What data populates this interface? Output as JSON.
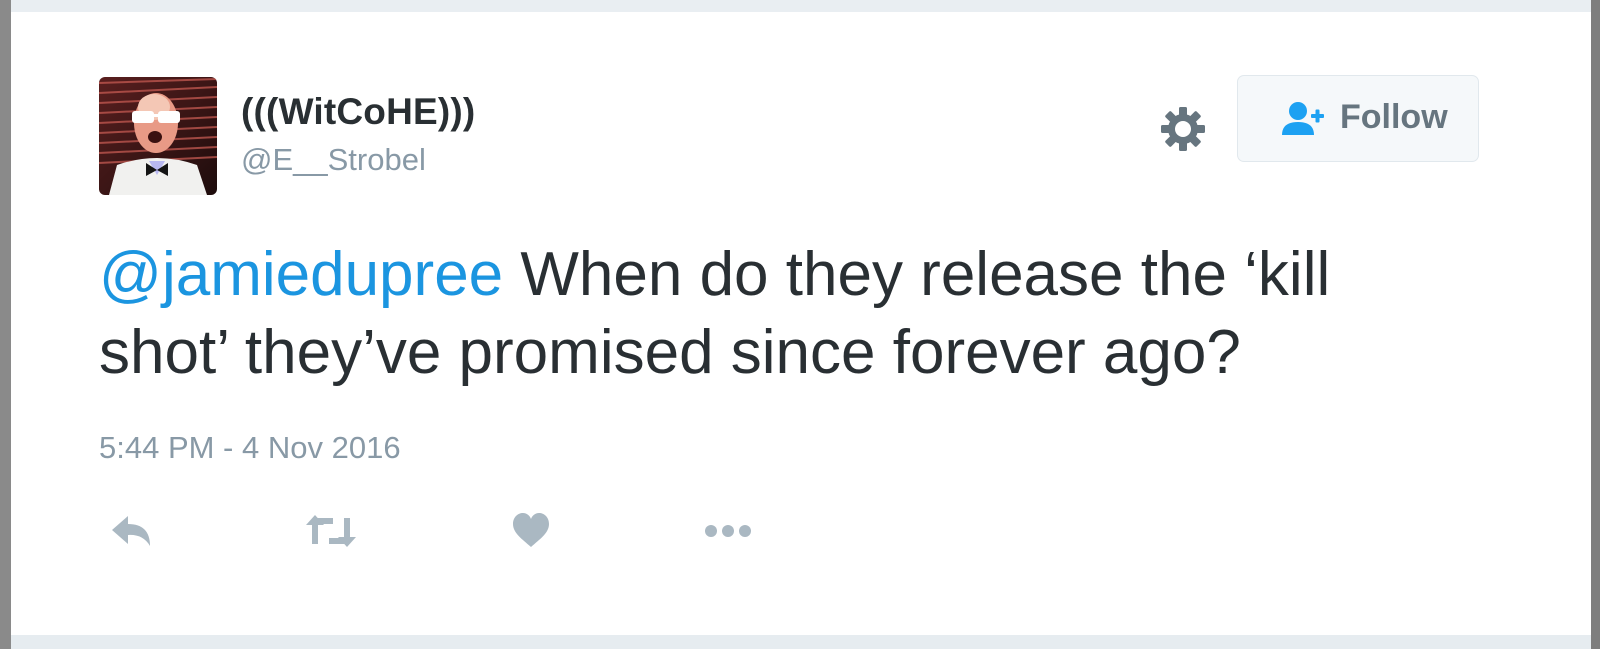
{
  "tweet": {
    "display_name": "(((WitCoHE)))",
    "handle": "@E__Strobel",
    "mention": "@jamiedupree",
    "body": " When do they release the ‘kill shot’ they’ve promised since forever ago?",
    "timestamp": "5:44 PM - 4 Nov 2016"
  },
  "header": {
    "follow_label": "Follow",
    "gear_icon": "gear-icon",
    "follow_icon": "add-user-icon"
  },
  "actions": [
    {
      "icon": "reply-icon"
    },
    {
      "icon": "retweet-icon"
    },
    {
      "icon": "heart-icon"
    },
    {
      "icon": "more-icon"
    }
  ],
  "colors": {
    "link": "#1b95e0",
    "text": "#292f33",
    "muted": "#8899a6",
    "icon": "#aab8c2"
  }
}
